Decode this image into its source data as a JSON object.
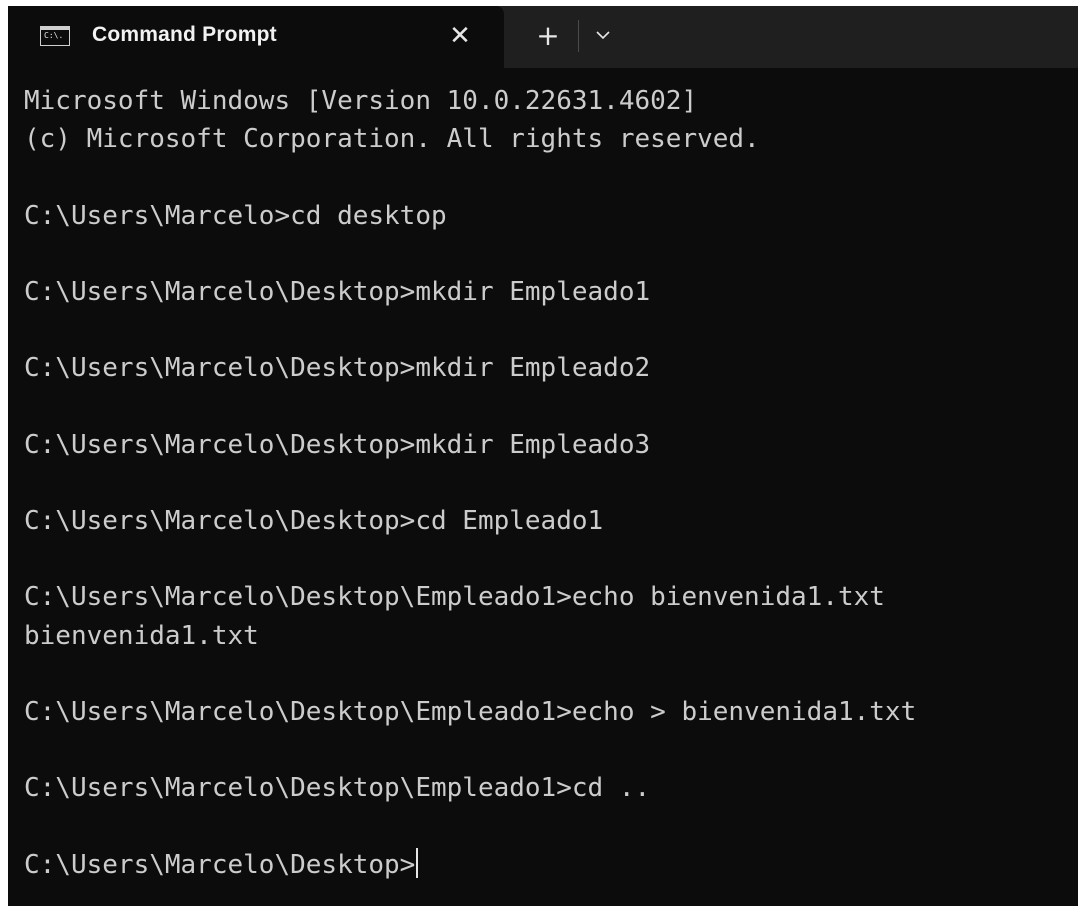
{
  "window": {
    "tab_title": "Command Prompt",
    "tab_icon_text": "C:\\.",
    "close_glyph": "✕",
    "new_tab_glyph": "+"
  },
  "terminal": {
    "lines": [
      "Microsoft Windows [Version 10.0.22631.4602]",
      "(c) Microsoft Corporation. All rights reserved.",
      "",
      "C:\\Users\\Marcelo>cd desktop",
      "",
      "C:\\Users\\Marcelo\\Desktop>mkdir Empleado1",
      "",
      "C:\\Users\\Marcelo\\Desktop>mkdir Empleado2",
      "",
      "C:\\Users\\Marcelo\\Desktop>mkdir Empleado3",
      "",
      "C:\\Users\\Marcelo\\Desktop>cd Empleado1",
      "",
      "C:\\Users\\Marcelo\\Desktop\\Empleado1>echo bienvenida1.txt",
      "bienvenida1.txt",
      "",
      "C:\\Users\\Marcelo\\Desktop\\Empleado1>echo > bienvenida1.txt",
      "",
      "C:\\Users\\Marcelo\\Desktop\\Empleado1>cd ..",
      "",
      "C:\\Users\\Marcelo\\Desktop>"
    ]
  },
  "colors": {
    "background": "#0c0c0c",
    "tabbar": "#1f1f1f",
    "text": "#cccccc"
  },
  "icons": {
    "tab_icon": "command-prompt-icon",
    "close": "close-icon",
    "new_tab": "plus-icon",
    "dropdown": "chevron-down-icon"
  }
}
